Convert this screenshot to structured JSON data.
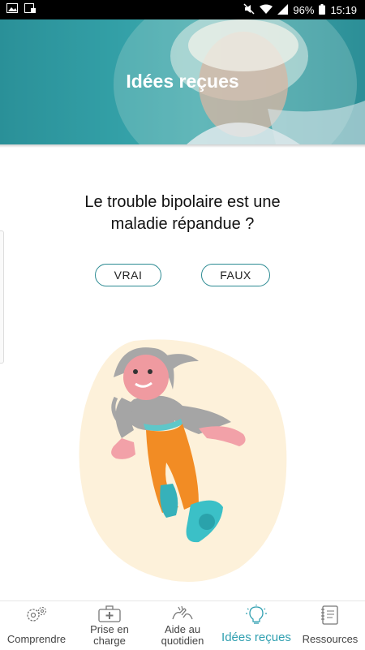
{
  "status_bar": {
    "battery": "96%",
    "time": "15:19"
  },
  "hero": {
    "title": "Idées reçues"
  },
  "quiz": {
    "question_line1": "Le trouble bipolaire est une",
    "question_line2": "maladie répandue ?",
    "true_label": "VRAI",
    "false_label": "FAUX"
  },
  "tabs": [
    {
      "label_line1": "Comprendre",
      "label_line2": "",
      "icon": "gears-icon"
    },
    {
      "label_line1": "Prise en",
      "label_line2": "charge",
      "icon": "medical-kit-icon"
    },
    {
      "label_line1": "Aide au",
      "label_line2": "quotidien",
      "icon": "helping-hands-icon"
    },
    {
      "label_line1": "Idées reçues",
      "label_line2": "",
      "icon": "lightbulb-icon",
      "active": true
    },
    {
      "label_line1": "Ressources",
      "label_line2": "",
      "icon": "notebook-icon"
    }
  ],
  "colors": {
    "accent": "#2f9fb0",
    "hero": "#36a3aa",
    "button_border": "#2b8a92"
  }
}
